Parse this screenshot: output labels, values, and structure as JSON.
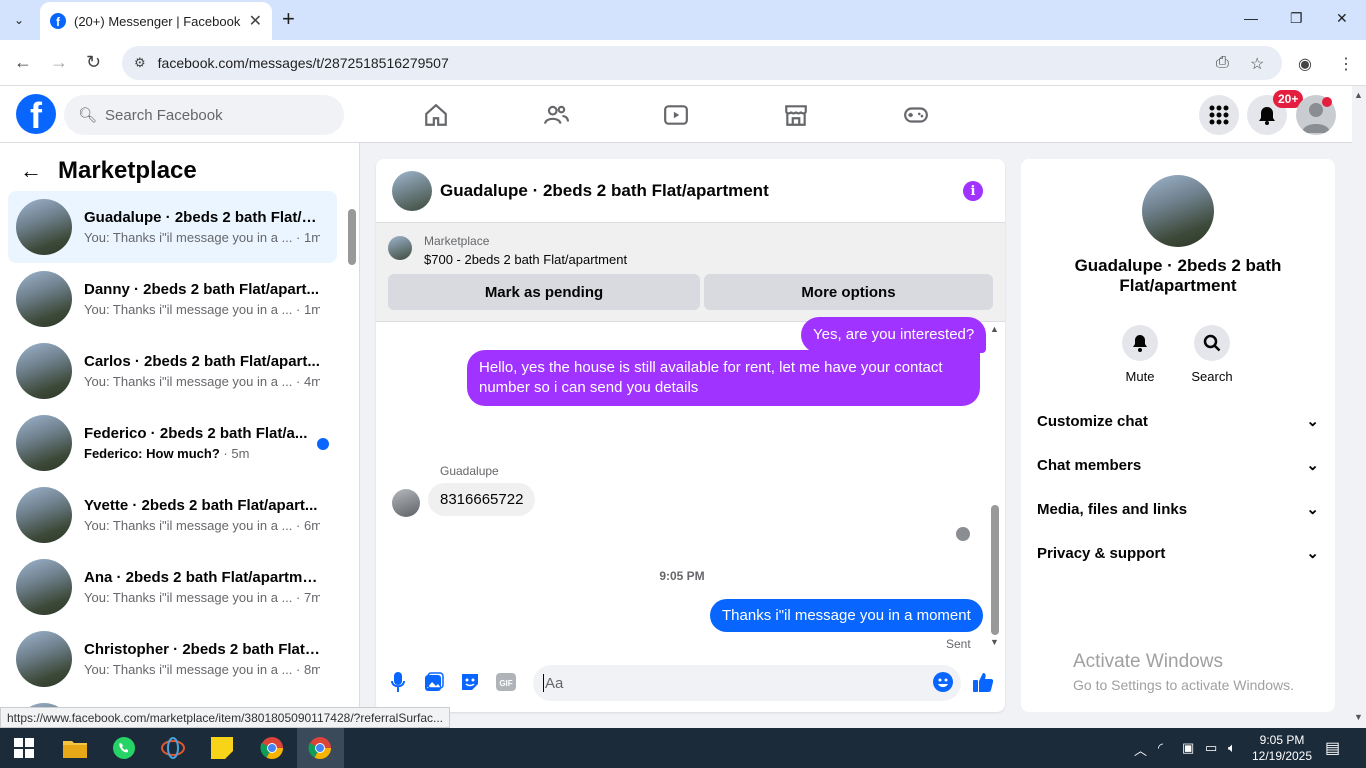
{
  "browser": {
    "tab_title": "(20+) Messenger | Facebook",
    "url": "facebook.com/messages/t/2872518516279507",
    "status_url": "https://www.facebook.com/marketplace/item/3801805090117428/?referralSurfac..."
  },
  "fb_header": {
    "search_placeholder": "Search Facebook",
    "notification_badge": "20+"
  },
  "sidebar": {
    "title": "Marketplace",
    "conversations": [
      {
        "name": "Guadalupe · 2beds 2 bath Flat/a...",
        "preview": "You: Thanks i\"il message you in a ...",
        "time": "· 1m",
        "active": true
      },
      {
        "name": "Danny · 2beds 2 bath Flat/apart...",
        "preview": "You: Thanks i\"il message you in a ...",
        "time": "· 1m"
      },
      {
        "name": "Carlos · 2beds 2 bath Flat/apart...",
        "preview": "You: Thanks i\"il message you in a ...",
        "time": "· 4m"
      },
      {
        "name": "Federico · 2beds 2 bath Flat/a...",
        "preview": "Federico: How much?",
        "time": "· 5m",
        "unread": true
      },
      {
        "name": "Yvette · 2beds 2 bath Flat/apart...",
        "preview": "You: Thanks i\"il message you in a ...",
        "time": "· 6m"
      },
      {
        "name": "Ana · 2beds 2 bath Flat/apartme...",
        "preview": "You: Thanks i\"il message you in a ...",
        "time": "· 7m"
      },
      {
        "name": "Christopher · 2beds 2 bath Flat/...",
        "preview": "You: Thanks i\"il message you in a ...",
        "time": "· 8m"
      }
    ]
  },
  "chat": {
    "title": "Guadalupe · 2beds 2 bath Flat/apartment",
    "marketplace_label": "Marketplace",
    "listing": "$700 - 2beds 2 bath Flat/apartment",
    "mark_pending": "Mark as pending",
    "more_options": "More options",
    "messages": {
      "m1": "Yes, are you interested?",
      "m2": "Hello, yes the house is still available for rent, let me have your contact number so i can send you  details",
      "sender_name": "Guadalupe",
      "m3": "8316665722",
      "time_sep": "9:05 PM",
      "m4": "Thanks i\"il message you in a moment",
      "sent": "Sent"
    },
    "composer_placeholder": "Aa"
  },
  "right_panel": {
    "name": "Guadalupe · 2beds 2 bath Flat/apartment",
    "mute": "Mute",
    "search": "Search",
    "rows": [
      "Customize chat",
      "Chat members",
      "Media, files and links",
      "Privacy & support"
    ],
    "activate_title": "Activate Windows",
    "activate_sub": "Go to Settings to activate Windows."
  },
  "taskbar": {
    "time": "9:05 PM",
    "date": "12/19/2025"
  },
  "colors": {
    "fb_blue": "#0866ff",
    "purple_bubble": "#a033ff",
    "badge_red": "#e41e3f"
  }
}
